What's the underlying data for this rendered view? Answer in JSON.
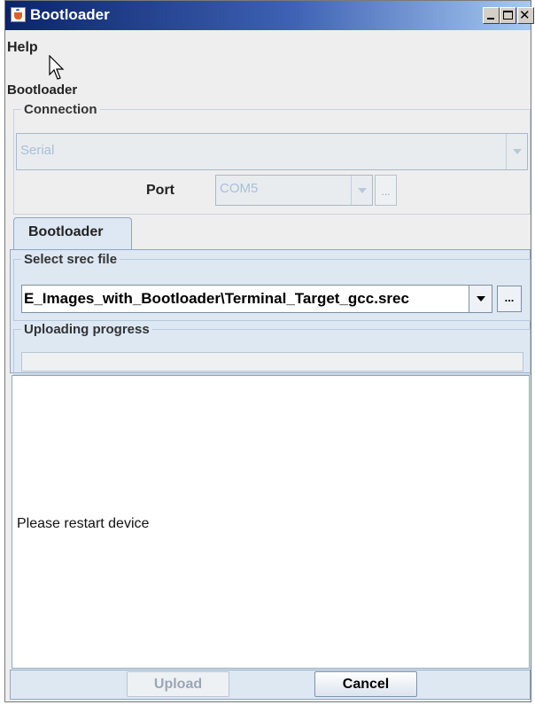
{
  "window": {
    "title": "Bootloader",
    "icon": "java-cup-icon"
  },
  "menu": {
    "help": "Help"
  },
  "panel_title": "Bootloader",
  "connection": {
    "legend": "Connection",
    "type_value": "Serial",
    "port_label": "Port",
    "port_value": "COM5",
    "port_browse": "..."
  },
  "tabs": [
    {
      "label": "Bootloader",
      "selected": true
    }
  ],
  "srec": {
    "legend": "Select srec file",
    "value": "E_Images_with_Bootloader\\Terminal_Target_gcc.srec",
    "browse": "..."
  },
  "upload_progress": {
    "legend": "Uploading progress",
    "fraction": 0
  },
  "log": {
    "text": "Please restart device"
  },
  "buttons": {
    "upload": "Upload",
    "cancel": "Cancel"
  },
  "colors": {
    "titlebar_start": "#0a246a",
    "titlebar_end": "#a6caf0",
    "panel_bg": "#dde8f3"
  }
}
